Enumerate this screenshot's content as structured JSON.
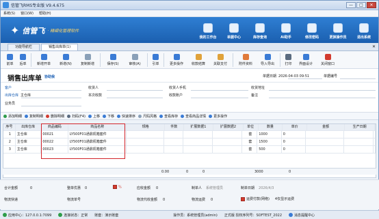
{
  "window": {
    "title": "信管飞RMS专业版 V9.4.675",
    "controls": [
      "—",
      "□",
      "✕"
    ]
  },
  "menu": [
    "系统(S)",
    "窗口(W)",
    "帮助(H)"
  ],
  "brand": {
    "logo": "信管飞",
    "slogan": "· 精细化管理软件"
  },
  "topnav": [
    {
      "label": "我的工作台",
      "icon": "monitor-icon"
    },
    {
      "label": "单据中心",
      "icon": "document-icon"
    },
    {
      "label": "库存查询",
      "icon": "warehouse-icon"
    },
    {
      "label": "AI助手",
      "icon": "ai-icon"
    },
    {
      "label": "修改密码",
      "icon": "lock-icon"
    },
    {
      "label": "更换操作员",
      "icon": "users-icon"
    },
    {
      "label": "退出系统",
      "icon": "power-icon"
    }
  ],
  "tabs": [
    {
      "label": "功能导航栏"
    },
    {
      "label": "销售出库单(1)"
    }
  ],
  "toolbar": [
    {
      "label": "前单",
      "icon": "arrow-left-icon",
      "color": "#3a7bd5"
    },
    {
      "label": "后单",
      "icon": "arrow-right-icon",
      "color": "#3a7bd5"
    },
    {
      "label": "新增开单",
      "icon": "new-doc-icon",
      "color": "#3a7bd5"
    },
    {
      "label": "新增(N)",
      "icon": "add-icon",
      "color": "#3a7bd5"
    },
    {
      "label": "复制新增",
      "icon": "copy-icon",
      "color": "#8aa0b8"
    },
    {
      "label": "保存(S)",
      "icon": "save-icon",
      "color": "#3a7bd5"
    },
    {
      "label": "审核(A)",
      "icon": "audit-icon",
      "color": "#8aa0b8"
    },
    {
      "label": "引单",
      "icon": "import-icon",
      "color": "#3a7bd5"
    },
    {
      "label": "更多操作",
      "icon": "more-icon",
      "color": "#3a7bd5"
    },
    {
      "label": "收款结算",
      "icon": "payment-icon",
      "color": "#e0a23a"
    },
    {
      "label": "关联支付",
      "icon": "link-icon",
      "color": "#e0a23a"
    },
    {
      "label": "附件资料",
      "icon": "attach-icon",
      "color": "#e07a3a"
    },
    {
      "label": "导入导出",
      "icon": "import-export-icon",
      "color": "#3a7bd5"
    },
    {
      "label": "打印",
      "icon": "print-icon",
      "color": "#5a6b80"
    },
    {
      "label": "界面设计",
      "icon": "design-icon",
      "color": "#3a7bd5"
    },
    {
      "label": "关闭窗口",
      "icon": "close-window-icon",
      "color": "#d23b2f"
    }
  ],
  "form": {
    "title": "销售出库单",
    "subtitle": "协助我",
    "date_label": "单据日期",
    "date_value": "2026-04-03 09:51",
    "number_label": "单据编号",
    "number_value": "",
    "customer_label": "客户",
    "warehouse_label": "出库仓库",
    "warehouse_value": "主仓库",
    "salesman_label": "业务员",
    "receiver_label": "收货人",
    "discount_label": "本次收款",
    "phone_label": "收货人手机",
    "account_label": "收款账户",
    "address_label": "收货地址",
    "remark_label": "备注"
  },
  "gridtoolbar": [
    {
      "label": "添加明细",
      "icon": "add-row-icon",
      "color": "#2e9c4a"
    },
    {
      "label": "复制明细",
      "icon": "copy-row-icon",
      "color": "#3a7bd5"
    },
    {
      "label": "删除明细",
      "icon": "delete-row-icon",
      "color": "#d23b2f"
    },
    {
      "label": "扫码(F4)",
      "icon": "scan-icon",
      "color": "#5a6b80"
    },
    {
      "label": "上移",
      "icon": "up-icon",
      "color": "#3a7bd5"
    },
    {
      "label": "下移",
      "icon": "down-icon",
      "color": "#3a7bd5"
    },
    {
      "label": "快速排序",
      "icon": "sort-icon",
      "color": "#3a7bd5"
    },
    {
      "label": "尺码风格",
      "icon": "size-icon",
      "color": "#8aa0b8"
    },
    {
      "label": "查看库存",
      "icon": "stock-icon",
      "color": "#3a7bd5"
    },
    {
      "label": "查看商品详情",
      "icon": "detail-icon",
      "color": "#3a7bd5"
    },
    {
      "label": "更多操作",
      "icon": "more-icon",
      "color": "#3a7bd5"
    }
  ],
  "grid": {
    "columns": [
      "序号",
      "出库仓库",
      "商品编码",
      "商品名称",
      "规格",
      "件数",
      "扩展数据1",
      "扩展数据2",
      "单位",
      "数量",
      "单价",
      "金额",
      "生产日期",
      "备注"
    ],
    "rows": [
      [
        "1",
        "主仓库",
        "00021",
        "LY500F01通鼎机箱套件",
        "",
        "",
        "",
        "",
        "套",
        "1000",
        "0",
        "",
        "",
        ""
      ],
      [
        "2",
        "主仓库",
        "00022",
        "LY500F01通鼎机箱套件",
        "",
        "",
        "",
        "",
        "套",
        "1500",
        "0",
        "",
        "",
        ""
      ],
      [
        "3",
        "主仓库",
        "00023",
        "LY500F01通鼎机箱套件",
        "",
        "",
        "",
        "",
        "套",
        "500",
        "0",
        "",
        "",
        ""
      ]
    ],
    "totals": {
      "qty1": "0.00",
      "qty2": "0",
      "qty3": "0",
      "amount": "3000",
      "price": "0"
    }
  },
  "footer": {
    "total_label": "合计金额",
    "total_value": "0",
    "discount_label": "整单优惠",
    "discount_value": "0",
    "receivable_label": "应收金额",
    "receivable_value": "0",
    "maker_label": "制单人",
    "maker_value": "系统管理员",
    "makedate_label": "制单日期",
    "makedate_value": "2026/4/3",
    "logistics_label": "物流快递",
    "waybill_label": "物流单号",
    "shipfee_label": "物流代收金额",
    "shipfee_value": "0",
    "shipcost_label": "物流运费",
    "shipcost_value": "0",
    "freightpay_label": "运费付款",
    "freightpay_value": "",
    "freight_note": "4仅显示运费",
    "freight_sub": "运费付款(网络)"
  },
  "status": {
    "server": "应用中心：127.0.0.1:7099",
    "connect": "连接状态：正常",
    "account": "账套：演示账套",
    "operator": "操作员：系统管理员(admin)",
    "edition": "正式版 授权序列号：SOFTEST_2022",
    "msg": "消息提醒中心"
  }
}
